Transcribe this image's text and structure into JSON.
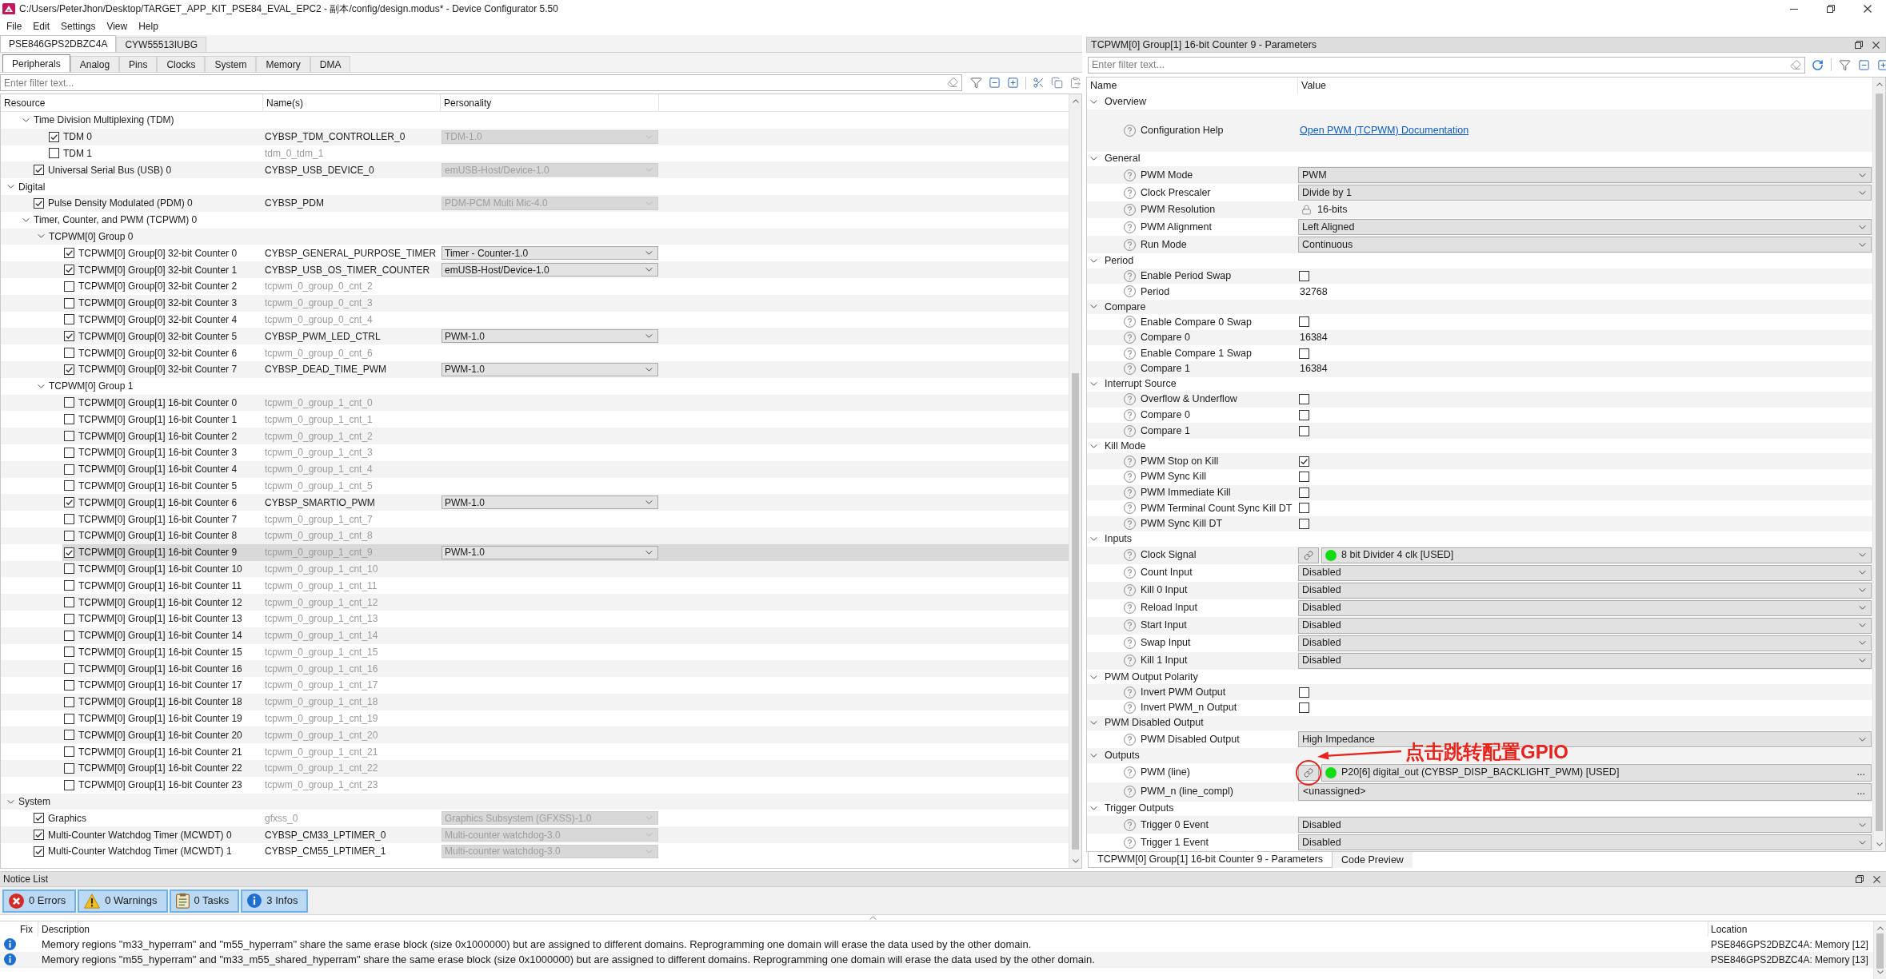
{
  "window": {
    "title": "C:/Users/PeterJhon/Desktop/TARGET_APP_KIT_PSE84_EVAL_EPC2 - 副本/config/design.modus* - Device Configurator 5.50"
  },
  "menu": [
    "File",
    "Edit",
    "Settings",
    "View",
    "Help"
  ],
  "device_tabs": [
    {
      "label": "PSE846GPS2DBZC4A",
      "selected": true
    },
    {
      "label": "CYW55513IUBG",
      "selected": false
    }
  ],
  "resource_tabs": [
    {
      "label": "Peripherals",
      "selected": true
    },
    {
      "label": "Analog",
      "selected": false
    },
    {
      "label": "Pins",
      "selected": false
    },
    {
      "label": "Clocks",
      "selected": false
    },
    {
      "label": "System",
      "selected": false
    },
    {
      "label": "Memory",
      "selected": false
    },
    {
      "label": "DMA",
      "selected": false
    }
  ],
  "resources": {
    "filter": {
      "placeholder": "Enter filter text..."
    },
    "columns": [
      "Resource",
      "Name(s)",
      "Personality"
    ],
    "tree": [
      {
        "children": [
          {
            "label": "Time Division Multiplexing (TDM)",
            "expanded": true,
            "selected": false,
            "children": [
              {
                "label": "TDM 0",
                "checked": true,
                "selected": false,
                "name": "CYBSP_TDM_CONTROLLER_0",
                "default_name": false,
                "personality": "TDM-1.0",
                "locked": true
              },
              {
                "label": "TDM 1",
                "checked": false,
                "selected": false,
                "name": "tdm_0_tdm_1",
                "default_name": true
              }
            ]
          },
          {
            "label": "Universal Serial Bus (USB) 0",
            "checked": true,
            "selected": false,
            "name": "CYBSP_USB_DEVICE_0",
            "default_name": false,
            "personality": "emUSB-Host/Device-1.0",
            "locked": true
          }
        ]
      },
      {
        "label": "Digital",
        "expanded": true,
        "selected": false,
        "children": [
          {
            "label": "Pulse Density Modulated (PDM) 0",
            "checked": true,
            "selected": false,
            "name": "CYBSP_PDM",
            "default_name": false,
            "personality": "PDM-PCM Multi Mic-4.0",
            "locked": true
          },
          {
            "label": "Timer, Counter, and PWM (TCPWM) 0",
            "expanded": true,
            "selected": false,
            "children": [
              {
                "label": "TCPWM[0] Group 0",
                "expanded": true,
                "selected": false,
                "children": [
                  {
                    "label": "TCPWM[0] Group[0] 32-bit Counter 0",
                    "checked": true,
                    "selected": false,
                    "name": "CYBSP_GENERAL_PURPOSE_TIMER",
                    "default_name": false,
                    "personality": "Timer - Counter-1.0",
                    "locked": false
                  },
                  {
                    "label": "TCPWM[0] Group[0] 32-bit Counter 1",
                    "checked": true,
                    "selected": false,
                    "name": "CYBSP_USB_OS_TIMER_COUNTER",
                    "default_name": false,
                    "personality": "emUSB-Host/Device-1.0",
                    "locked": false
                  },
                  {
                    "label": "TCPWM[0] Group[0] 32-bit Counter 2",
                    "checked": false,
                    "selected": false,
                    "name": "tcpwm_0_group_0_cnt_2",
                    "default_name": true
                  },
                  {
                    "label": "TCPWM[0] Group[0] 32-bit Counter 3",
                    "checked": false,
                    "selected": false,
                    "name": "tcpwm_0_group_0_cnt_3",
                    "default_name": true
                  },
                  {
                    "label": "TCPWM[0] Group[0] 32-bit Counter 4",
                    "checked": false,
                    "selected": false,
                    "name": "tcpwm_0_group_0_cnt_4",
                    "default_name": true
                  },
                  {
                    "label": "TCPWM[0] Group[0] 32-bit Counter 5",
                    "checked": true,
                    "selected": false,
                    "name": "CYBSP_PWM_LED_CTRL",
                    "default_name": false,
                    "personality": "PWM-1.0",
                    "locked": false
                  },
                  {
                    "label": "TCPWM[0] Group[0] 32-bit Counter 6",
                    "checked": false,
                    "selected": false,
                    "name": "tcpwm_0_group_0_cnt_6",
                    "default_name": true
                  },
                  {
                    "label": "TCPWM[0] Group[0] 32-bit Counter 7",
                    "checked": true,
                    "selected": false,
                    "name": "CYBSP_DEAD_TIME_PWM",
                    "default_name": false,
                    "personality": "PWM-1.0",
                    "locked": false
                  }
                ]
              },
              {
                "label": "TCPWM[0] Group 1",
                "expanded": true,
                "selected": false,
                "children": [
                  {
                    "label": "TCPWM[0] Group[1] 16-bit Counter 0",
                    "checked": false,
                    "selected": false,
                    "name": "tcpwm_0_group_1_cnt_0",
                    "default_name": true
                  },
                  {
                    "label": "TCPWM[0] Group[1] 16-bit Counter 1",
                    "checked": false,
                    "selected": false,
                    "name": "tcpwm_0_group_1_cnt_1",
                    "default_name": true
                  },
                  {
                    "label": "TCPWM[0] Group[1] 16-bit Counter 2",
                    "checked": false,
                    "selected": false,
                    "name": "tcpwm_0_group_1_cnt_2",
                    "default_name": true
                  },
                  {
                    "label": "TCPWM[0] Group[1] 16-bit Counter 3",
                    "checked": false,
                    "selected": false,
                    "name": "tcpwm_0_group_1_cnt_3",
                    "default_name": true
                  },
                  {
                    "label": "TCPWM[0] Group[1] 16-bit Counter 4",
                    "checked": false,
                    "selected": false,
                    "name": "tcpwm_0_group_1_cnt_4",
                    "default_name": true
                  },
                  {
                    "label": "TCPWM[0] Group[1] 16-bit Counter 5",
                    "checked": false,
                    "selected": false,
                    "name": "tcpwm_0_group_1_cnt_5",
                    "default_name": true
                  },
                  {
                    "label": "TCPWM[0] Group[1] 16-bit Counter 6",
                    "checked": true,
                    "selected": false,
                    "name": "CYBSP_SMARTIO_PWM",
                    "default_name": false,
                    "personality": "PWM-1.0",
                    "locked": false
                  },
                  {
                    "label": "TCPWM[0] Group[1] 16-bit Counter 7",
                    "checked": false,
                    "selected": false,
                    "name": "tcpwm_0_group_1_cnt_7",
                    "default_name": true
                  },
                  {
                    "label": "TCPWM[0] Group[1] 16-bit Counter 8",
                    "checked": false,
                    "selected": false,
                    "name": "tcpwm_0_group_1_cnt_8",
                    "default_name": true
                  },
                  {
                    "label": "TCPWM[0] Group[1] 16-bit Counter 9",
                    "checked": true,
                    "selected": true,
                    "name": "tcpwm_0_group_1_cnt_9",
                    "default_name": true,
                    "personality": "PWM-1.0",
                    "locked": false
                  },
                  {
                    "label": "TCPWM[0] Group[1] 16-bit Counter 10",
                    "checked": false,
                    "selected": false,
                    "name": "tcpwm_0_group_1_cnt_10",
                    "default_name": true
                  },
                  {
                    "label": "TCPWM[0] Group[1] 16-bit Counter 11",
                    "checked": false,
                    "selected": false,
                    "name": "tcpwm_0_group_1_cnt_11",
                    "default_name": true
                  },
                  {
                    "label": "TCPWM[0] Group[1] 16-bit Counter 12",
                    "checked": false,
                    "selected": false,
                    "name": "tcpwm_0_group_1_cnt_12",
                    "default_name": true
                  },
                  {
                    "label": "TCPWM[0] Group[1] 16-bit Counter 13",
                    "checked": false,
                    "selected": false,
                    "name": "tcpwm_0_group_1_cnt_13",
                    "default_name": true
                  },
                  {
                    "label": "TCPWM[0] Group[1] 16-bit Counter 14",
                    "checked": false,
                    "selected": false,
                    "name": "tcpwm_0_group_1_cnt_14",
                    "default_name": true
                  },
                  {
                    "label": "TCPWM[0] Group[1] 16-bit Counter 15",
                    "checked": false,
                    "selected": false,
                    "name": "tcpwm_0_group_1_cnt_15",
                    "default_name": true
                  },
                  {
                    "label": "TCPWM[0] Group[1] 16-bit Counter 16",
                    "checked": false,
                    "selected": false,
                    "name": "tcpwm_0_group_1_cnt_16",
                    "default_name": true
                  },
                  {
                    "label": "TCPWM[0] Group[1] 16-bit Counter 17",
                    "checked": false,
                    "selected": false,
                    "name": "tcpwm_0_group_1_cnt_17",
                    "default_name": true
                  },
                  {
                    "label": "TCPWM[0] Group[1] 16-bit Counter 18",
                    "checked": false,
                    "selected": false,
                    "name": "tcpwm_0_group_1_cnt_18",
                    "default_name": true
                  },
                  {
                    "label": "TCPWM[0] Group[1] 16-bit Counter 19",
                    "checked": false,
                    "selected": false,
                    "name": "tcpwm_0_group_1_cnt_19",
                    "default_name": true
                  },
                  {
                    "label": "TCPWM[0] Group[1] 16-bit Counter 20",
                    "checked": false,
                    "selected": false,
                    "name": "tcpwm_0_group_1_cnt_20",
                    "default_name": true
                  },
                  {
                    "label": "TCPWM[0] Group[1] 16-bit Counter 21",
                    "checked": false,
                    "selected": false,
                    "name": "tcpwm_0_group_1_cnt_21",
                    "default_name": true
                  },
                  {
                    "label": "TCPWM[0] Group[1] 16-bit Counter 22",
                    "checked": false,
                    "selected": false,
                    "name": "tcpwm_0_group_1_cnt_22",
                    "default_name": true
                  },
                  {
                    "label": "TCPWM[0] Group[1] 16-bit Counter 23",
                    "checked": false,
                    "selected": false,
                    "name": "tcpwm_0_group_1_cnt_23",
                    "default_name": true
                  }
                ]
              }
            ]
          }
        ]
      },
      {
        "label": "System",
        "expanded": true,
        "selected": false,
        "children": [
          {
            "label": "Graphics",
            "checked": true,
            "selected": false,
            "name": "gfxss_0",
            "default_name": true,
            "personality": "Graphics Subsystem (GFXSS)-1.0",
            "locked": true
          },
          {
            "label": "Multi-Counter Watchdog Timer (MCWDT) 0",
            "checked": true,
            "selected": false,
            "name": "CYBSP_CM33_LPTIMER_0",
            "default_name": false,
            "personality": "Multi-counter watchdog-3.0",
            "locked": true
          },
          {
            "label": "Multi-Counter Watchdog Timer (MCWDT) 1",
            "checked": true,
            "selected": false,
            "name": "CYBSP_CM55_LPTIMER_1",
            "default_name": false,
            "personality": "Multi-counter watchdog-3.0",
            "locked": true
          }
        ]
      }
    ]
  },
  "parameters": {
    "title": "TCPWM[0] Group[1] 16-bit Counter 9 - Parameters",
    "filter": {
      "placeholder": "Enter filter text..."
    },
    "columns": [
      "Name",
      "Value"
    ],
    "groups": [
      {
        "label": "Overview",
        "expanded": true,
        "items": [
          {
            "label": "Configuration Help",
            "kind": "link",
            "value": "Open PWM (TCPWM) Documentation"
          }
        ]
      },
      {
        "label": "General",
        "expanded": true,
        "items": [
          {
            "label": "PWM Mode",
            "kind": "dropdown",
            "value": "PWM"
          },
          {
            "label": "Clock Prescaler",
            "kind": "dropdown",
            "value": "Divide by 1"
          },
          {
            "label": "PWM Resolution",
            "kind": "locked",
            "value": "16-bits"
          },
          {
            "label": "PWM Alignment",
            "kind": "dropdown",
            "value": "Left Aligned"
          },
          {
            "label": "Run Mode",
            "kind": "dropdown",
            "value": "Continuous"
          }
        ]
      },
      {
        "label": "Period",
        "expanded": true,
        "items": [
          {
            "label": "Enable Period Swap",
            "kind": "checkbox",
            "checked": false
          },
          {
            "label": "Period",
            "kind": "text",
            "value": "32768"
          }
        ]
      },
      {
        "label": "Compare",
        "expanded": true,
        "items": [
          {
            "label": "Enable Compare 0 Swap",
            "kind": "checkbox",
            "checked": false
          },
          {
            "label": "Compare 0",
            "kind": "text",
            "value": "16384"
          },
          {
            "label": "Enable Compare 1 Swap",
            "kind": "checkbox",
            "checked": false
          },
          {
            "label": "Compare 1",
            "kind": "text",
            "value": "16384"
          }
        ]
      },
      {
        "label": "Interrupt Source",
        "expanded": true,
        "items": [
          {
            "label": "Overflow & Underflow",
            "kind": "checkbox",
            "checked": false
          },
          {
            "label": "Compare 0",
            "kind": "checkbox",
            "checked": false
          },
          {
            "label": "Compare 1",
            "kind": "checkbox",
            "checked": false
          }
        ]
      },
      {
        "label": "Kill Mode",
        "expanded": true,
        "items": [
          {
            "label": "PWM Stop on Kill",
            "kind": "checkbox",
            "checked": true
          },
          {
            "label": "PWM Sync Kill",
            "kind": "checkbox",
            "checked": false
          },
          {
            "label": "PWM Immediate Kill",
            "kind": "checkbox",
            "checked": false
          },
          {
            "label": "PWM Terminal Count Sync Kill DT",
            "kind": "checkbox",
            "checked": false
          },
          {
            "label": "PWM Sync Kill DT",
            "kind": "checkbox",
            "checked": false
          }
        ]
      },
      {
        "label": "Inputs",
        "expanded": true,
        "items": [
          {
            "label": "Clock Signal",
            "kind": "signal",
            "value": "8 bit Divider 4 clk [USED]",
            "color": "#14dc14"
          },
          {
            "label": "Count Input",
            "kind": "dropdown",
            "value": "Disabled"
          },
          {
            "label": "Kill 0 Input",
            "kind": "dropdown",
            "value": "Disabled"
          },
          {
            "label": "Reload Input",
            "kind": "dropdown",
            "value": "Disabled"
          },
          {
            "label": "Start Input",
            "kind": "dropdown",
            "value": "Disabled"
          },
          {
            "label": "Swap Input",
            "kind": "dropdown",
            "value": "Disabled"
          },
          {
            "label": "Kill 1 Input",
            "kind": "dropdown",
            "value": "Disabled"
          }
        ]
      },
      {
        "label": "PWM Output Polarity",
        "expanded": true,
        "items": [
          {
            "label": "Invert PWM Output",
            "kind": "checkbox",
            "checked": false
          },
          {
            "label": "Invert PWM_n Output",
            "kind": "checkbox",
            "checked": false
          }
        ]
      },
      {
        "label": "PWM Disabled Output",
        "expanded": true,
        "items": [
          {
            "label": "PWM Disabled Output",
            "kind": "dropdown",
            "value": "High Impedance"
          }
        ]
      },
      {
        "label": "Outputs",
        "expanded": true,
        "items": [
          {
            "label": "PWM (line)",
            "kind": "pin",
            "value": "P20[6] digital_out (CYBSP_DISP_BACKLIGHT_PWM) [USED]",
            "color": "#14dc14",
            "button": "...",
            "highlighted": true
          },
          {
            "label": "PWM_n (line_compl)",
            "kind": "assign",
            "value": "<unassigned>",
            "button": "..."
          }
        ]
      },
      {
        "label": "Trigger Outputs",
        "expanded": true,
        "items": [
          {
            "label": "Trigger 0 Event",
            "kind": "dropdown",
            "value": "Disabled"
          },
          {
            "label": "Trigger 1 Event",
            "kind": "dropdown",
            "value": "Disabled"
          }
        ]
      }
    ],
    "tabs": [
      {
        "label": "TCPWM[0] Group[1] 16-bit Counter 9 - Parameters",
        "selected": true
      },
      {
        "label": "Code Preview",
        "selected": false
      }
    ]
  },
  "notice_list": {
    "title": "Notice List",
    "filters": [
      {
        "kind": "error",
        "label": "0 Errors",
        "on": true
      },
      {
        "kind": "warning",
        "label": "0 Warnings",
        "on": true
      },
      {
        "kind": "task",
        "label": "0 Tasks",
        "on": true
      },
      {
        "kind": "info",
        "label": "3 Infos",
        "on": true
      }
    ],
    "columns": [
      "Fix",
      "Description",
      "Location"
    ],
    "rows": [
      {
        "kind": "info",
        "description": "Memory regions \"m33_hyperram\" and \"m55_hyperram\" share the same erase block (size 0x1000000) but are assigned to different domains. Reprogramming one domain will erase the data used by the other domain.",
        "location": "PSE846GPS2DBZC4A: Memory [12]"
      },
      {
        "kind": "info",
        "description": "Memory regions \"m55_hyperram\" and \"m33_m55_shared_hyperram\" share the same erase block (size 0x1000000) but are assigned to different domains. Reprogramming one domain will erase the data used by the other domain.",
        "location": "PSE846GPS2DBZC4A: Memory [13]"
      }
    ]
  },
  "annotation": {
    "text": "点击跳转配置GPIO"
  }
}
